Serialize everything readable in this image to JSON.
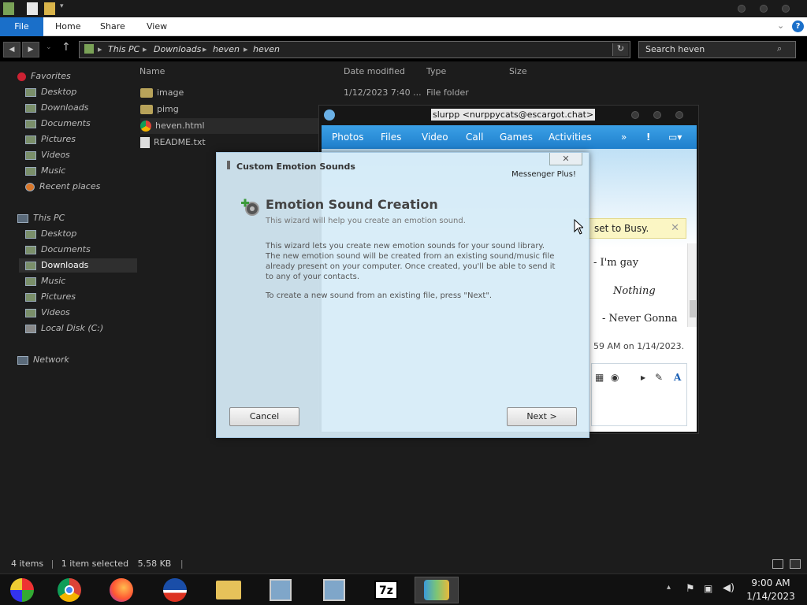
{
  "explorer": {
    "ribbon": {
      "file": "File",
      "home": "Home",
      "share": "Share",
      "view": "View"
    },
    "address": {
      "seg1": "This PC",
      "seg2": "Downloads",
      "seg3": "heven",
      "seg4": "heven"
    },
    "search_placeholder": "Search heven",
    "nav": {
      "favorites": "Favorites",
      "fav_desktop": "Desktop",
      "fav_downloads": "Downloads",
      "fav_documents": "Documents",
      "fav_pictures": "Pictures",
      "fav_videos": "Videos",
      "fav_music": "Music",
      "fav_recent": "Recent places",
      "thispc": "This PC",
      "pc_desktop": "Desktop",
      "pc_documents": "Documents",
      "pc_downloads": "Downloads",
      "pc_music": "Music",
      "pc_pictures": "Pictures",
      "pc_videos": "Videos",
      "pc_disk": "Local Disk (C:)",
      "network": "Network"
    },
    "columns": {
      "name": "Name",
      "date": "Date modified",
      "type": "Type",
      "size": "Size"
    },
    "files": [
      {
        "name": "image",
        "date": "1/12/2023 7:40 ...",
        "type": "File folder"
      },
      {
        "name": "pimg"
      },
      {
        "name": "heven.html"
      },
      {
        "name": "README.txt"
      }
    ],
    "status": {
      "count": "4 items",
      "selected": "1 item selected",
      "size": "5.58 KB"
    }
  },
  "messenger": {
    "title": "slurpp <nurppycats@escargot.chat>",
    "toolbar": {
      "photos": "Photos",
      "files": "Files",
      "video": "Video",
      "call": "Call",
      "games": "Games",
      "activities": "Activities",
      "more": "»",
      "alert": "!"
    },
    "busy_text": "set to Busy.",
    "chat_lines": [
      "- I'm gay",
      "Nothing",
      "- Never Gonna",
      "59 AM on 1/14/2023."
    ]
  },
  "wizard": {
    "window_title": "Custom Emotion Sounds",
    "brand": "Messenger Plus!",
    "heading": "Emotion Sound Creation",
    "subheading": "This wizard will help you create an emotion sound.",
    "description": "This wizard lets you create new emotion sounds for your sound library. The new emotion sound will be created from an existing sound/music file already present on your computer. Once created, you'll be able to send it to any of your contacts.",
    "hint": "To create a new sound from an existing file, press \"Next\".",
    "cancel": "Cancel",
    "next": "Next >"
  },
  "taskbar": {
    "apps": [
      "messenger-app",
      "chrome",
      "firefox",
      "obama-app",
      "file-explorer",
      "setup-app-1",
      "setup-app-2",
      "7zip",
      "messenger-plus"
    ],
    "sevenzip_label": "7z",
    "time": "9:00 AM",
    "date": "1/14/2023"
  },
  "colors": {
    "ribbon_file": "#1a6fc9",
    "msn_toolbar": "#2b8fd8",
    "busy_bg": "#fbf6c4"
  }
}
